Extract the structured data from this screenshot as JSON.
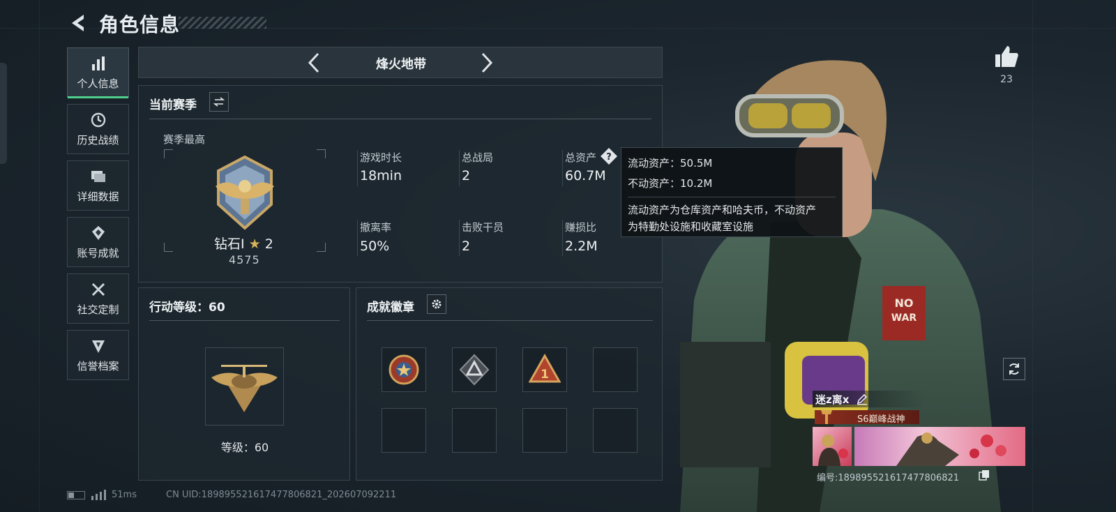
{
  "header": {
    "title": "角色信息"
  },
  "sidebar": {
    "items": [
      {
        "label": "个人信息",
        "icon": "bar-chart-icon",
        "active": true
      },
      {
        "label": "历史战绩",
        "icon": "history-icon"
      },
      {
        "label": "详细数据",
        "icon": "folder-icon"
      },
      {
        "label": "账号成就",
        "icon": "achievement-icon"
      },
      {
        "label": "社交定制",
        "icon": "tools-icon"
      },
      {
        "label": "信誉档案",
        "icon": "shield-icon"
      }
    ]
  },
  "mode": {
    "title": "烽火地带"
  },
  "season": {
    "title": "当前赛季",
    "best_label": "赛季最高",
    "rank_name": "钻石Ⅰ",
    "rank_stars": "2",
    "rank_score": "4575",
    "stats": [
      {
        "label": "游戏时长",
        "value": "18min"
      },
      {
        "label": "总战局",
        "value": "2"
      },
      {
        "label": "总资产",
        "value": "60.7M"
      },
      {
        "label": "撤离率",
        "value": "50%"
      },
      {
        "label": "击败干员",
        "value": "2"
      },
      {
        "label": "赚损比",
        "value": "2.2M"
      }
    ]
  },
  "tooltip": {
    "liquid": "流动资产：50.5M",
    "fixed": "不动资产：10.2M",
    "desc_line1": "流动资产为仓库资产和哈夫币，不动资产",
    "desc_line2": "为特勤处设施和收藏室设施"
  },
  "action_level": {
    "title": "行动等级：60",
    "level_text": "等级：60"
  },
  "achievements": {
    "title": "成就徽章"
  },
  "profile": {
    "likes": "23",
    "player_name": "迷z离x",
    "player_title": "S6巅峰战神",
    "player_id": "编号:18989552161747780​6821"
  },
  "footer": {
    "ping": "51ms",
    "uid": "CN UID:18989552161747780​6821_202607092211"
  },
  "colors": {
    "accent": "#4fd18b",
    "tooltip_bg": "#0e1216",
    "title_bar": "#8a2e1e"
  }
}
